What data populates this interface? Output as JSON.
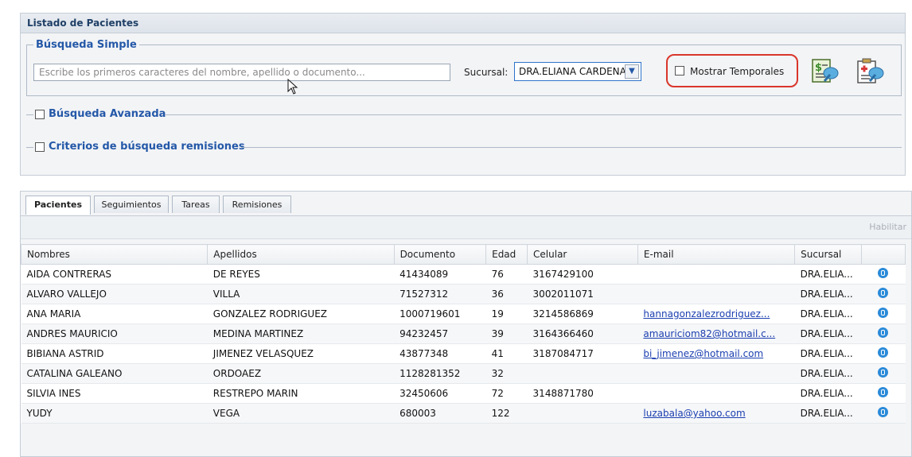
{
  "panel_title": "Listado de Pacientes",
  "simple": {
    "legend": "Búsqueda Simple",
    "placeholder": "Escribe los primeros caracteres del nombre, apellido o documento...",
    "sucursal_label": "Sucursal:",
    "sucursal_value": "DRA.ELIANA CARDENAS",
    "temporales_label": "Mostrar Temporales",
    "icon_1": "billing-report-icon",
    "icon_2": "medical-report-icon"
  },
  "advanced": {
    "label": "Búsqueda Avanzada"
  },
  "remisiones": {
    "label": "Criterios de búsqueda remisiones"
  },
  "tabs": [
    "Pacientes",
    "Seguimientos",
    "Tareas",
    "Remisiones"
  ],
  "toolbar": {
    "habilitar": "Habilitar"
  },
  "table": {
    "columns": [
      "Nombres",
      "Apellidos",
      "Documento",
      "Edad",
      "Celular",
      "E-mail",
      "Sucursal",
      ""
    ],
    "rows": [
      [
        "AIDA CONTRERAS",
        "DE REYES",
        "41434089",
        "76",
        "3167429100",
        "",
        "DRA.ELIA..."
      ],
      [
        "ALVARO VALLEJO",
        "VILLA",
        "71527312",
        "36",
        "3002011071",
        "",
        "DRA.ELIA..."
      ],
      [
        "ANA MARIA",
        "GONZALEZ RODRIGUEZ",
        "1000719601",
        "19",
        "3214586869",
        "hannagonzalezrodriguez...",
        "DRA.ELIA..."
      ],
      [
        "ANDRES MAURICIO",
        "MEDINA MARTINEZ",
        "94232457",
        "39",
        "3164366460",
        "amauriciom82@hotmail.c...",
        "DRA.ELIA..."
      ],
      [
        "BIBIANA ASTRID",
        "JIMENEZ VELASQUEZ",
        "43877348",
        "41",
        "3187084717",
        "bi_jimenez@hotmail.com",
        "DRA.ELIA..."
      ],
      [
        "CATALINA GALEANO",
        "ORDOAEZ",
        "1128281352",
        "32",
        "",
        "",
        "DRA.ELIA..."
      ],
      [
        "SILVIA INES",
        "RESTREPO MARIN",
        "32450606",
        "72",
        "3148871780",
        "",
        "DRA.ELIA..."
      ],
      [
        "YUDY",
        "VEGA",
        "680003",
        "122",
        "",
        "luzabala@yahoo.com",
        "DRA.ELIA..."
      ]
    ],
    "row_icon": "contact-card-icon"
  }
}
